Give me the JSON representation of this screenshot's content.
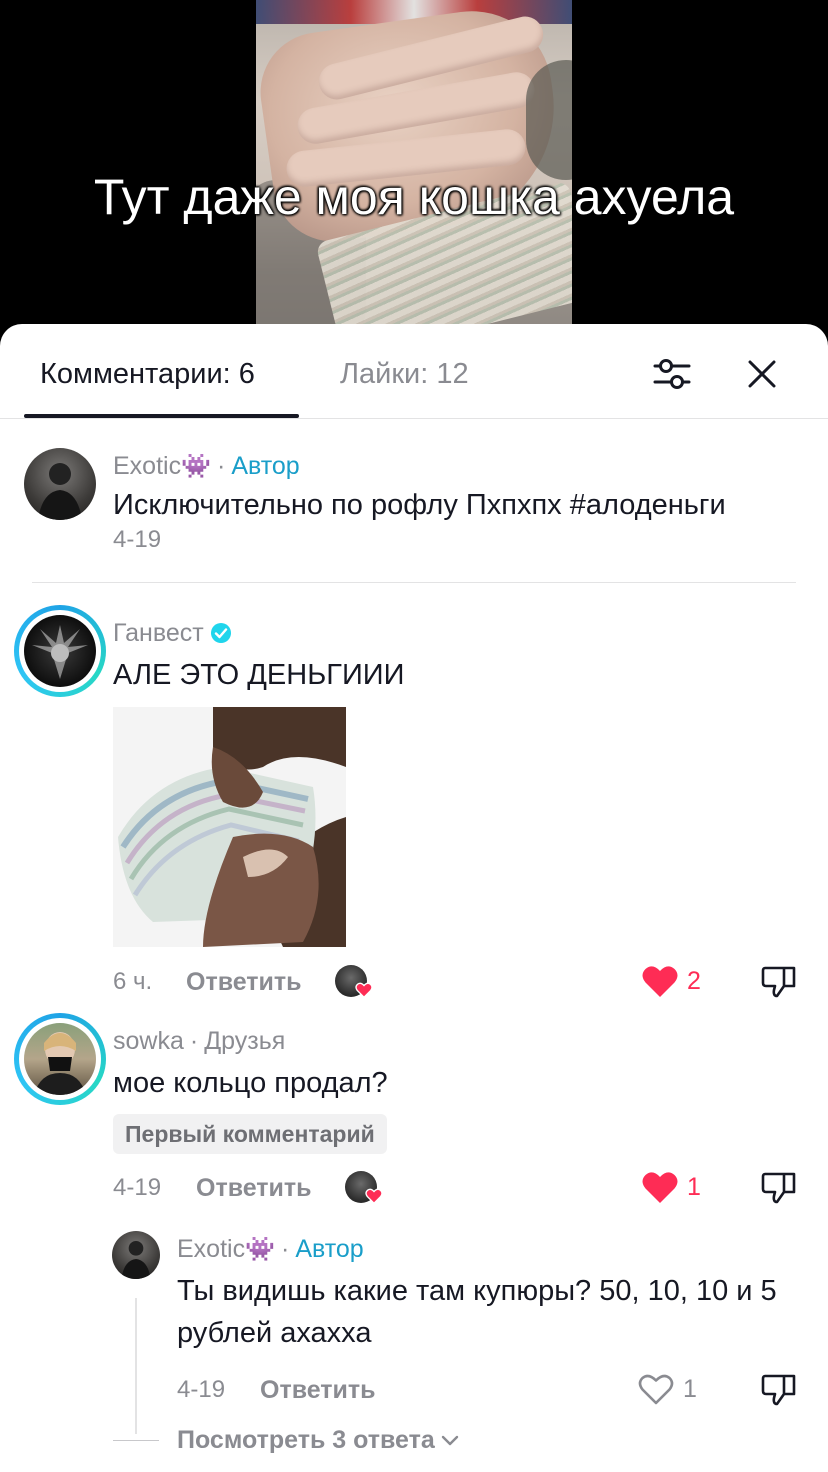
{
  "video": {
    "caption": "Тут даже моя кошка ахуела"
  },
  "tabs": {
    "comments_label": "Комментарии: 6",
    "likes_label": "Лайки: 12"
  },
  "comments": [
    {
      "author": "Exotic",
      "author_emoji": "👾",
      "tag": "Автор",
      "text": "Исключительно по рофлу Пхпхпх #алоденьги",
      "date": "4-19"
    },
    {
      "author": "Ганвест",
      "verified": true,
      "text": "АЛЕ ЭТО ДЕНЬГИИИ",
      "date": "6 ч.",
      "reply_label": "Ответить",
      "likes": "2",
      "liked": true
    },
    {
      "author": "sowka",
      "tag": "Друзья",
      "text": "мое кольцо продал?",
      "badge": "Первый комментарий",
      "date": "4-19",
      "reply_label": "Ответить",
      "likes": "1",
      "liked": true,
      "replies": [
        {
          "author": "Exotic",
          "author_emoji": "👾",
          "tag": "Автор",
          "text": "Ты видишь какие там купюры? 50, 10, 10 и 5 рублей ахахха",
          "date": "4-19",
          "reply_label": "Ответить",
          "likes": "1",
          "liked": false
        }
      ],
      "view_replies_label": "Посмотреть 3 ответа"
    }
  ],
  "colors": {
    "like_red": "#fe2c55",
    "author_tag": "#1a9ec9",
    "verified": "#20d5ec",
    "muted": "#8a8b91"
  }
}
